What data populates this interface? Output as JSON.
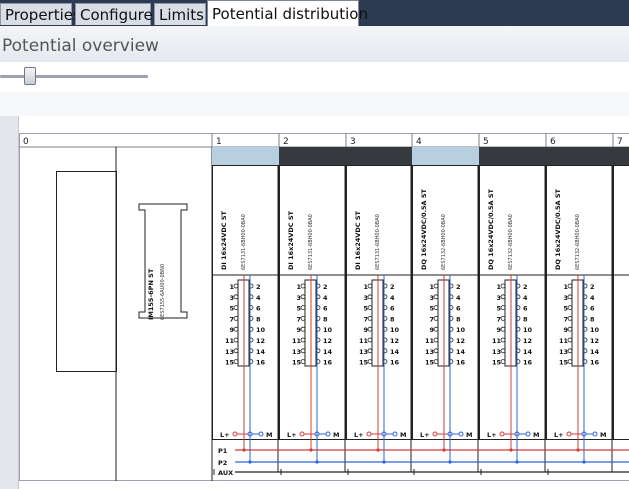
{
  "tabs": [
    {
      "label": "Properties",
      "active": false
    },
    {
      "label": "Configure",
      "active": false
    },
    {
      "label": "Limits",
      "active": false
    },
    {
      "label": "Potential distribution",
      "active": true
    }
  ],
  "panel": {
    "title": "Potential overview"
  },
  "zoom_slider": {
    "level": 0.2
  },
  "rack": {
    "slot_numbers": [
      "0",
      "1",
      "2",
      "3",
      "4",
      "5",
      "6",
      "7"
    ],
    "interface_module": {
      "label": "IM155-6PN ST",
      "order_number": "6ES7155-6AU00-0BN0"
    },
    "modules": [
      {
        "slot": "1",
        "name": "DI 16x24VDC ST",
        "order_number": "6ES7131-6BH00-0BA0",
        "group_color": "#b8cfdf"
      },
      {
        "slot": "2",
        "name": "DI 16x24VDC ST",
        "order_number": "6ES7131-6BH00-0BA0",
        "group_color": "#36393e"
      },
      {
        "slot": "3",
        "name": "DI 16x24VDC ST",
        "order_number": "6ES7131-6BH00-0BA0",
        "group_color": "#36393e"
      },
      {
        "slot": "4",
        "name": "DQ 16x24VDC/0.5A ST",
        "order_number": "6ES7132-6BH00-0BA0",
        "group_color": "#b8cfdf"
      },
      {
        "slot": "5",
        "name": "DQ 16x24VDC/0.5A ST",
        "order_number": "6ES7132-6BH00-0BA0",
        "group_color": "#36393e"
      },
      {
        "slot": "6",
        "name": "DQ 16x24VDC/0.5A ST",
        "order_number": "6ES7132-6BH00-0BA0",
        "group_color": "#36393e"
      }
    ],
    "terminals_left": [
      "1",
      "3",
      "5",
      "7",
      "9",
      "11",
      "13",
      "15"
    ],
    "terminals_right": [
      "2",
      "4",
      "6",
      "8",
      "10",
      "12",
      "14",
      "16"
    ],
    "supply_left": "L+",
    "supply_right": "M",
    "bus_labels": [
      "P1",
      "P2",
      "AUX"
    ]
  },
  "colors": {
    "p1": "#d43b3b",
    "p2": "#2f63d6",
    "light_group": "#b8cfdf",
    "dark_group": "#36393e"
  }
}
